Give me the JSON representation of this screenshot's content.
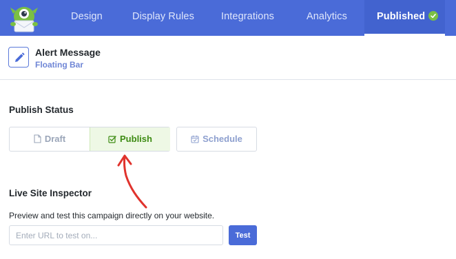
{
  "nav": {
    "items": [
      {
        "label": "Design",
        "active": false
      },
      {
        "label": "Display Rules",
        "active": false
      },
      {
        "label": "Integrations",
        "active": false
      },
      {
        "label": "Analytics",
        "active": false
      },
      {
        "label": "Published",
        "active": true,
        "icon": "check-circle-icon"
      }
    ],
    "logo_icon": "optinmonster-logo"
  },
  "campaign": {
    "title": "Alert Message",
    "type": "Floating Bar",
    "edit_icon": "pencil-icon"
  },
  "publish_status": {
    "heading": "Publish Status",
    "options": [
      {
        "label": "Draft",
        "icon": "file-icon",
        "selected": false
      },
      {
        "label": "Publish",
        "icon": "checkbox-check-icon",
        "selected": true
      },
      {
        "label": "Schedule",
        "icon": "calendar-check-icon",
        "selected": false
      }
    ]
  },
  "live_site_inspector": {
    "heading": "Live Site Inspector",
    "description": "Preview and test this campaign directly on your website.",
    "url_placeholder": "Enter URL to test on...",
    "url_value": "",
    "test_label": "Test"
  },
  "colors": {
    "nav_bg": "#4a6bd8",
    "accent": "#4a6bd8",
    "success": "#3d8b13",
    "success_bg": "#eef8e5",
    "annotation_arrow": "#e0332d"
  }
}
